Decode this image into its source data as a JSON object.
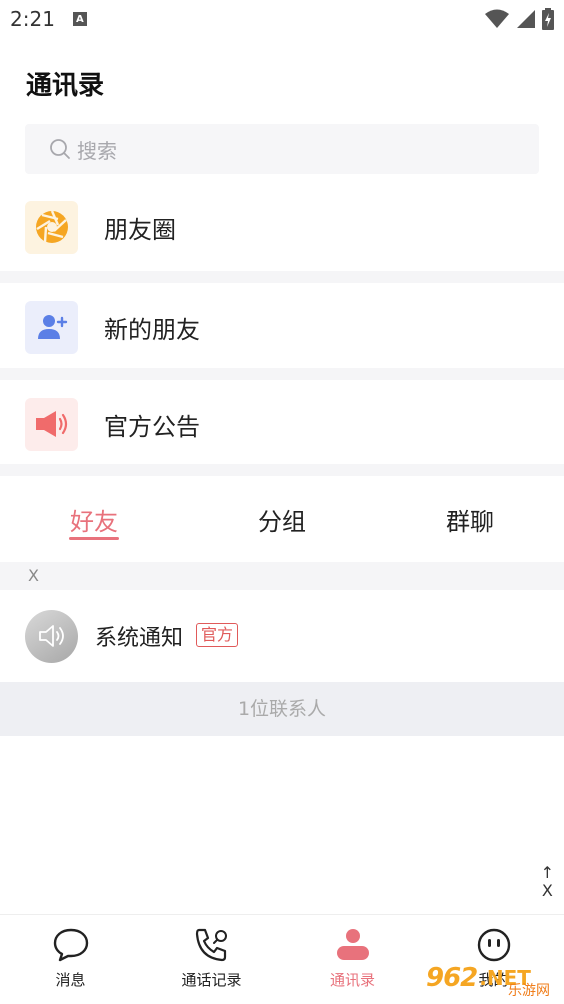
{
  "status": {
    "time": "2:21",
    "notif_badge": "A"
  },
  "header": {
    "title": "通讯录"
  },
  "search": {
    "placeholder": "搜索"
  },
  "menu": [
    {
      "label": "朋友圈",
      "icon": "aperture-icon",
      "bg": "#fdf3e0",
      "color": "#f5a623"
    },
    {
      "label": "新的朋友",
      "icon": "add-user-icon",
      "bg": "#ebeefb",
      "color": "#5b7fe6"
    },
    {
      "label": "官方公告",
      "icon": "megaphone-icon",
      "bg": "#fdeceb",
      "color": "#f06b6b"
    }
  ],
  "tabs": [
    {
      "label": "好友",
      "active": true
    },
    {
      "label": "分组",
      "active": false
    },
    {
      "label": "群聊",
      "active": false
    }
  ],
  "contacts": {
    "section_letter": "X",
    "items": [
      {
        "name": "系统通知",
        "badge": "官方"
      }
    ],
    "count_text": "1位联系人"
  },
  "index_bar": {
    "arrow": "↑",
    "letter": "X"
  },
  "bottom_nav": [
    {
      "label": "消息",
      "icon": "chat-bubble-icon",
      "active": false
    },
    {
      "label": "通话记录",
      "icon": "phone-icon",
      "active": false
    },
    {
      "label": "通讯录",
      "icon": "contacts-icon",
      "active": true
    },
    {
      "label": "我的",
      "icon": "face-icon",
      "active": false
    }
  ],
  "colors": {
    "accent": "#e8727c",
    "official": "#e05a5a"
  },
  "watermark": {
    "logo_a": "962",
    "logo_b": ".NET",
    "sub": "乐游网"
  }
}
